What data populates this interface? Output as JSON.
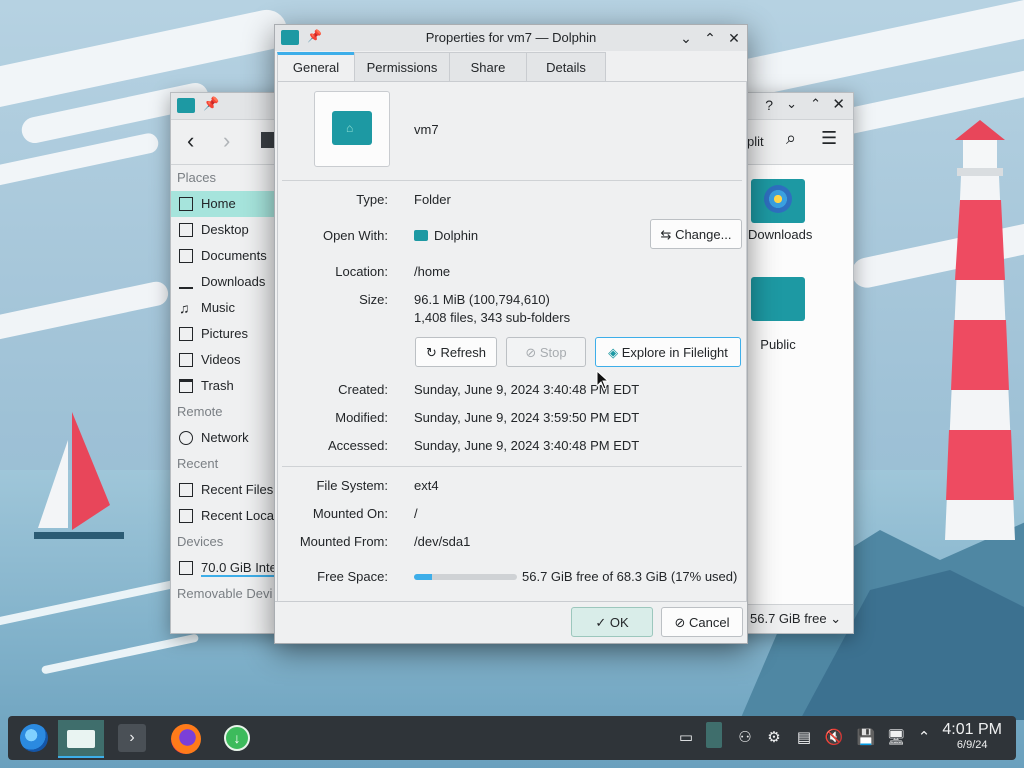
{
  "background_window": {
    "title_icons": [
      "folder-icon",
      "pin-icon"
    ],
    "toolbar": {
      "split_label": "plit"
    },
    "sidebar": {
      "sections": [
        {
          "header": "Places",
          "items": [
            {
              "label": "Home",
              "icon": "home-icon",
              "active": true
            },
            {
              "label": "Desktop",
              "icon": "desktop-icon"
            },
            {
              "label": "Documents",
              "icon": "documents-icon"
            },
            {
              "label": "Downloads",
              "icon": "downloads-icon"
            },
            {
              "label": "Music",
              "icon": "music-icon"
            },
            {
              "label": "Pictures",
              "icon": "pictures-icon"
            },
            {
              "label": "Videos",
              "icon": "videos-icon"
            },
            {
              "label": "Trash",
              "icon": "trash-icon"
            }
          ]
        },
        {
          "header": "Remote",
          "items": [
            {
              "label": "Network",
              "icon": "network-icon"
            }
          ]
        },
        {
          "header": "Recent",
          "items": [
            {
              "label": "Recent Files",
              "icon": "recent-files-icon"
            },
            {
              "label": "Recent Loca",
              "icon": "recent-locations-icon"
            }
          ]
        },
        {
          "header": "Devices",
          "items": [
            {
              "label": "70.0 GiB Inte",
              "icon": "drive-icon"
            }
          ]
        },
        {
          "header": "Removable Devi",
          "items": []
        }
      ]
    },
    "files": [
      {
        "label": "Downloads"
      },
      {
        "label": "Public"
      }
    ],
    "status": {
      "free_space": "56.7 GiB free"
    }
  },
  "dialog": {
    "title": "Properties for vm7 — Dolphin",
    "tabs": [
      "General",
      "Permissions",
      "Share",
      "Details"
    ],
    "active_tab": "General",
    "name": "vm7",
    "fields": {
      "type_label": "Type:",
      "type_value": "Folder",
      "open_with_label": "Open With:",
      "open_with_value": "Dolphin",
      "change_button": "Change...",
      "location_label": "Location:",
      "location_value": "/home",
      "size_label": "Size:",
      "size_value": "96.1 MiB (100,794,610)",
      "size_detail": "1,408 files, 343 sub-folders",
      "refresh_button": "Refresh",
      "stop_button": "Stop",
      "filelight_button": "Explore in Filelight",
      "created_label": "Created:",
      "created_value": "Sunday, June 9, 2024 3:40:48 PM EDT",
      "modified_label": "Modified:",
      "modified_value": "Sunday, June 9, 2024 3:59:50 PM EDT",
      "accessed_label": "Accessed:",
      "accessed_value": "Sunday, June 9, 2024 3:40:48 PM EDT",
      "filesystem_label": "File System:",
      "filesystem_value": "ext4",
      "mounted_on_label": "Mounted On:",
      "mounted_on_value": "/",
      "mounted_from_label": "Mounted From:",
      "mounted_from_value": "/dev/sda1",
      "free_space_label": "Free Space:",
      "free_space_value": "56.7 GiB free of 68.3 GiB (17% used)",
      "used_percent": 17
    },
    "ok_button": "OK",
    "cancel_button": "Cancel"
  },
  "taskbar": {
    "clock_time": "4:01 PM",
    "clock_date": "6/9/24"
  },
  "colors": {
    "accent": "#3daee9",
    "folder": "#1d99a3",
    "selection": "#a6e4dc",
    "taskbar": "#2f3439"
  }
}
